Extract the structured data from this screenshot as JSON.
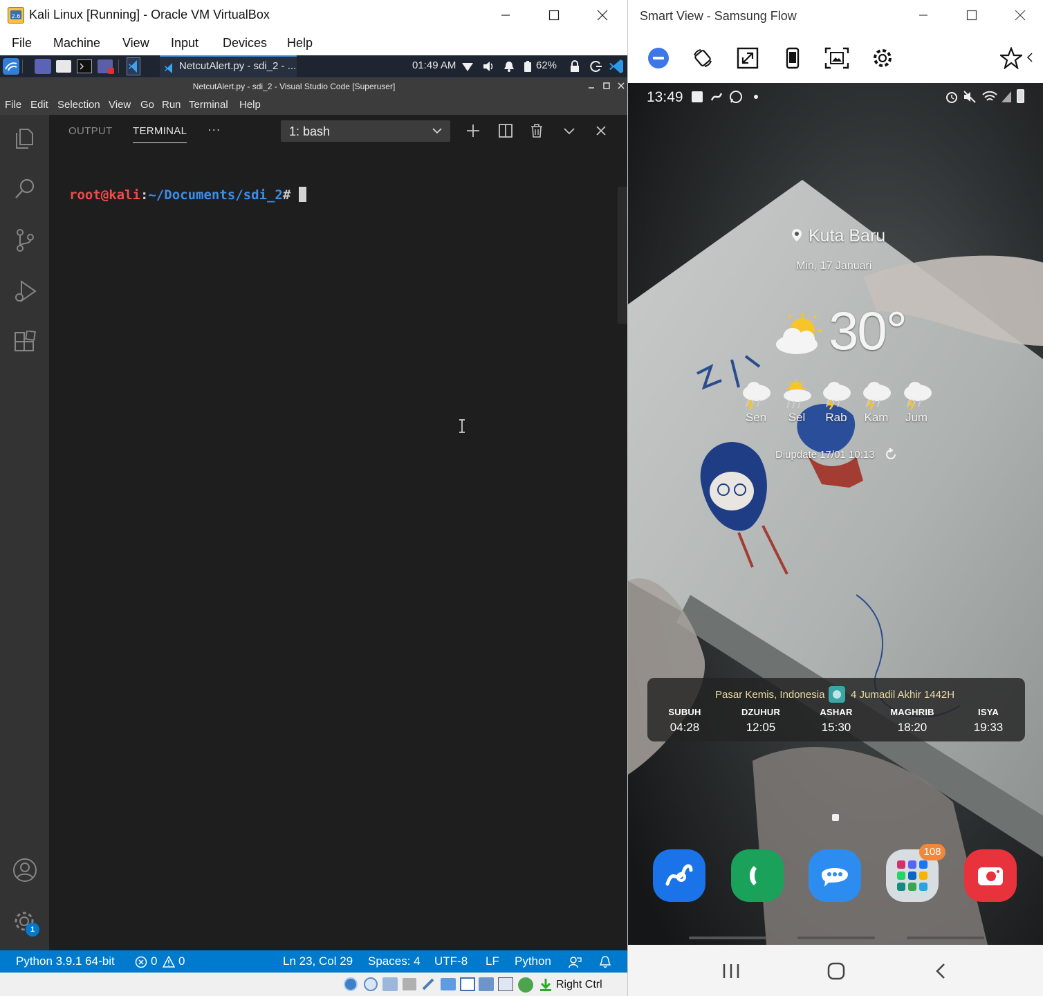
{
  "vbox": {
    "title": "Kali Linux [Running] - Oracle VM VirtualBox",
    "menu": [
      "File",
      "Machine",
      "View",
      "Input",
      "Devices",
      "Help"
    ]
  },
  "kali_panel": {
    "task_title": "NetcutAlert.py - sdi_2 - ...",
    "clock": "01:49 AM",
    "battery": "62%"
  },
  "vscode": {
    "title": "NetcutAlert.py - sdi_2 - Visual Studio Code [Superuser]",
    "menu": [
      "File",
      "Edit",
      "Selection",
      "View",
      "Go",
      "Run",
      "Terminal",
      "Help"
    ],
    "tabs": {
      "output": "OUTPUT",
      "terminal": "TERMINAL",
      "more": "···"
    },
    "terminal_select": "1: bash",
    "prompt": {
      "user": "root@kali",
      "sep": ":",
      "path": "~/Documents/sdi_2",
      "hash": "# "
    },
    "settings_badge": "1",
    "status": {
      "python": "Python 3.9.1 64-bit",
      "errors": "0",
      "warnings": "0",
      "position": "Ln 23, Col 29",
      "spaces": "Spaces: 4",
      "encoding": "UTF-8",
      "eol": "LF",
      "language": "Python"
    }
  },
  "vbox_status": {
    "host_key": "Right Ctrl"
  },
  "flow": {
    "title": "Smart View - Samsung Flow",
    "toolbar_icons": [
      "minus-circle-icon",
      "rotate-icon",
      "expand-icon",
      "phone-portrait-icon",
      "screenshot-icon",
      "settings-icon",
      "star-icon"
    ]
  },
  "phone": {
    "time": "13:49",
    "location": "Kuta Baru",
    "date": "Min, 17 Januari",
    "temperature": "30°",
    "forecast": [
      {
        "day": "Sen",
        "icon": "rain-thunder-icon"
      },
      {
        "day": "Sel",
        "icon": "sun-rain-icon"
      },
      {
        "day": "Rab",
        "icon": "rain-thunder-icon"
      },
      {
        "day": "Kam",
        "icon": "rain-thunder-icon"
      },
      {
        "day": "Jum",
        "icon": "rain-thunder-icon"
      }
    ],
    "updated": "Diupdate 17/01 10:13",
    "prayer": {
      "location": "Pasar Kemis, Indonesia",
      "hijri": "4 Jumadil Akhir 1442H",
      "times": [
        {
          "name": "SUBUH",
          "time": "04:28"
        },
        {
          "name": "DZUHUR",
          "time": "12:05"
        },
        {
          "name": "ASHAR",
          "time": "15:30"
        },
        {
          "name": "MAGHRIB",
          "time": "18:20"
        },
        {
          "name": "ISYA",
          "time": "19:33"
        }
      ]
    },
    "apps": [
      {
        "name": "samsung-flow-app",
        "color": "#1a73e8"
      },
      {
        "name": "phone-app",
        "color": "#1aa15a"
      },
      {
        "name": "messages-app",
        "color": "#2d8cf0"
      },
      {
        "name": "social-folder",
        "color": "#d7dde0"
      },
      {
        "name": "camera-app",
        "color": "#e8323c"
      }
    ],
    "folder_badge": "108"
  }
}
